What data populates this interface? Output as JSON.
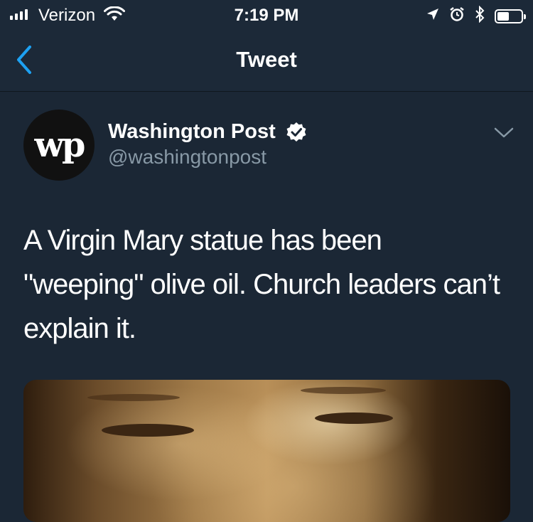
{
  "status_bar": {
    "carrier": "Verizon",
    "time": "7:19 PM",
    "signal_bars": 4,
    "battery_level": 0.5,
    "icons": [
      "signal-icon",
      "wifi-icon",
      "location-arrow-icon",
      "alarm-icon",
      "bluetooth-icon",
      "battery-icon"
    ]
  },
  "nav": {
    "title": "Tweet",
    "back_icon": "chevron-left-icon"
  },
  "tweet": {
    "author_name": "Washington Post",
    "author_handle": "@washingtonpost",
    "avatar_logo": "wp",
    "verified": true,
    "text": "A Virgin Mary statue has been \"weeping\" olive oil. Church leaders can’t explain it.",
    "menu_icon": "chevron-down-icon",
    "media_alt_icon": "photo"
  },
  "colors": {
    "background": "#1b2735",
    "bar_background": "#1c2938",
    "accent": "#1da1f2",
    "secondary_text": "#8899a6",
    "primary_text": "#ffffff"
  }
}
